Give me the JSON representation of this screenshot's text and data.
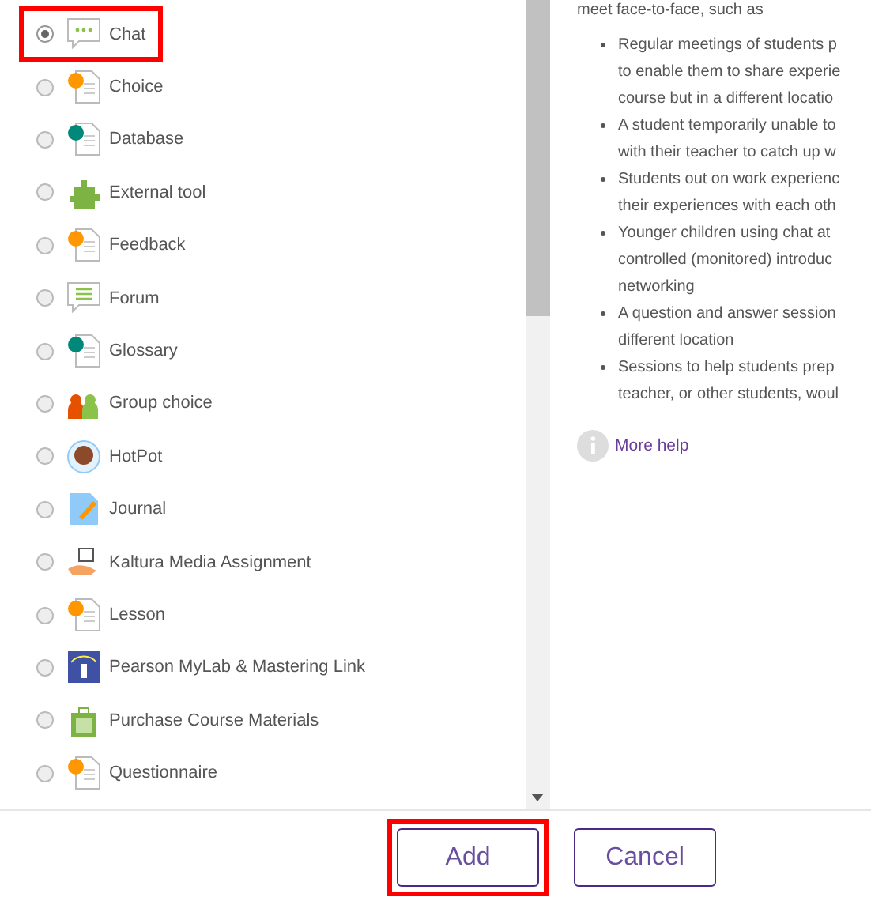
{
  "activities": [
    {
      "label": "Chat",
      "selected": true,
      "highlighted": true
    },
    {
      "label": "Choice",
      "selected": false,
      "highlighted": false
    },
    {
      "label": "Database",
      "selected": false,
      "highlighted": false
    },
    {
      "label": "External tool",
      "selected": false,
      "highlighted": false
    },
    {
      "label": "Feedback",
      "selected": false,
      "highlighted": false
    },
    {
      "label": "Forum",
      "selected": false,
      "highlighted": false
    },
    {
      "label": "Glossary",
      "selected": false,
      "highlighted": false
    },
    {
      "label": "Group choice",
      "selected": false,
      "highlighted": false
    },
    {
      "label": "HotPot",
      "selected": false,
      "highlighted": false
    },
    {
      "label": "Journal",
      "selected": false,
      "highlighted": false
    },
    {
      "label": "Kaltura Media Assignment",
      "selected": false,
      "highlighted": false
    },
    {
      "label": "Lesson",
      "selected": false,
      "highlighted": false
    },
    {
      "label": "Pearson MyLab & Mastering Link",
      "selected": false,
      "highlighted": false
    },
    {
      "label": "Purchase Course Materials",
      "selected": false,
      "highlighted": false
    },
    {
      "label": "Questionnaire",
      "selected": false,
      "highlighted": false
    }
  ],
  "help": {
    "intro": "meet face-to-face, such as",
    "bullets": [
      [
        "Regular meetings of students p",
        "to enable them to share experie",
        "course but in a different locatio"
      ],
      [
        "A student temporarily unable to",
        "with their teacher to catch up w"
      ],
      [
        "Students out on work experienc",
        "their experiences with each oth"
      ],
      [
        "Younger children using chat at",
        "controlled (monitored) introduc",
        "networking"
      ],
      [
        "A question and answer session",
        "different location"
      ],
      [
        "Sessions to help students prep",
        "teacher, or other students, woul"
      ]
    ],
    "more_help": "More help"
  },
  "buttons": [
    {
      "label": "Add",
      "highlighted": true
    },
    {
      "label": "Cancel",
      "highlighted": false
    }
  ]
}
